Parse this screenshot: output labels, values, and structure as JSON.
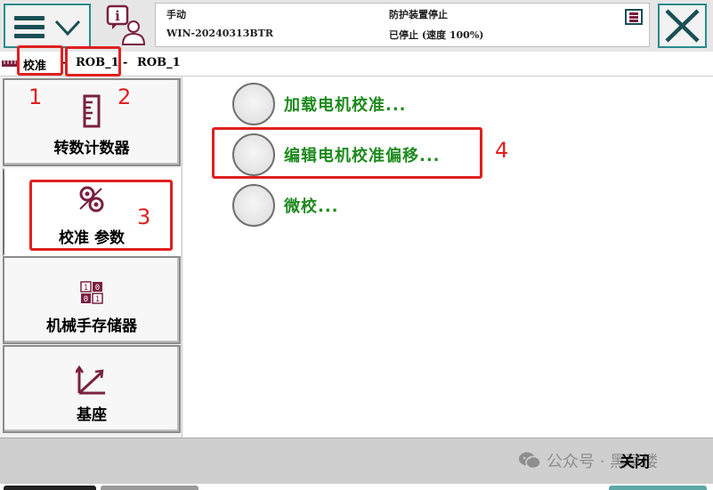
{
  "header": {
    "mode": "手动",
    "controller": "WIN-20240313BTR",
    "safety_status": "防护装置停止",
    "motor_status": "已停止 (速度 100%)"
  },
  "breadcrumb": {
    "items": [
      "校准",
      "ROB_1",
      "ROB_1"
    ],
    "separator": "-"
  },
  "sidebar": {
    "items": [
      {
        "label": "转数计数器",
        "icon": "revolution-counter-icon"
      },
      {
        "label": "校准 参数",
        "icon": "calibration-gears-icon"
      },
      {
        "label": "机械手存储器",
        "icon": "binary-memory-icon"
      },
      {
        "label": "基座",
        "icon": "base-axes-icon"
      }
    ],
    "selected_index": 1
  },
  "options": [
    {
      "label": "加载电机校准..."
    },
    {
      "label": "编辑电机校准偏移..."
    },
    {
      "label": "微校..."
    }
  ],
  "annotations": [
    "1",
    "2",
    "3",
    "4"
  ],
  "footer": {
    "close_label": "关闭",
    "watermark": "公众号 · 黑草楼"
  },
  "colors": {
    "accent": "#2a8a8c",
    "option_text": "#1e8a1e",
    "annotation": "#e02020",
    "icon": "#7a2040"
  }
}
